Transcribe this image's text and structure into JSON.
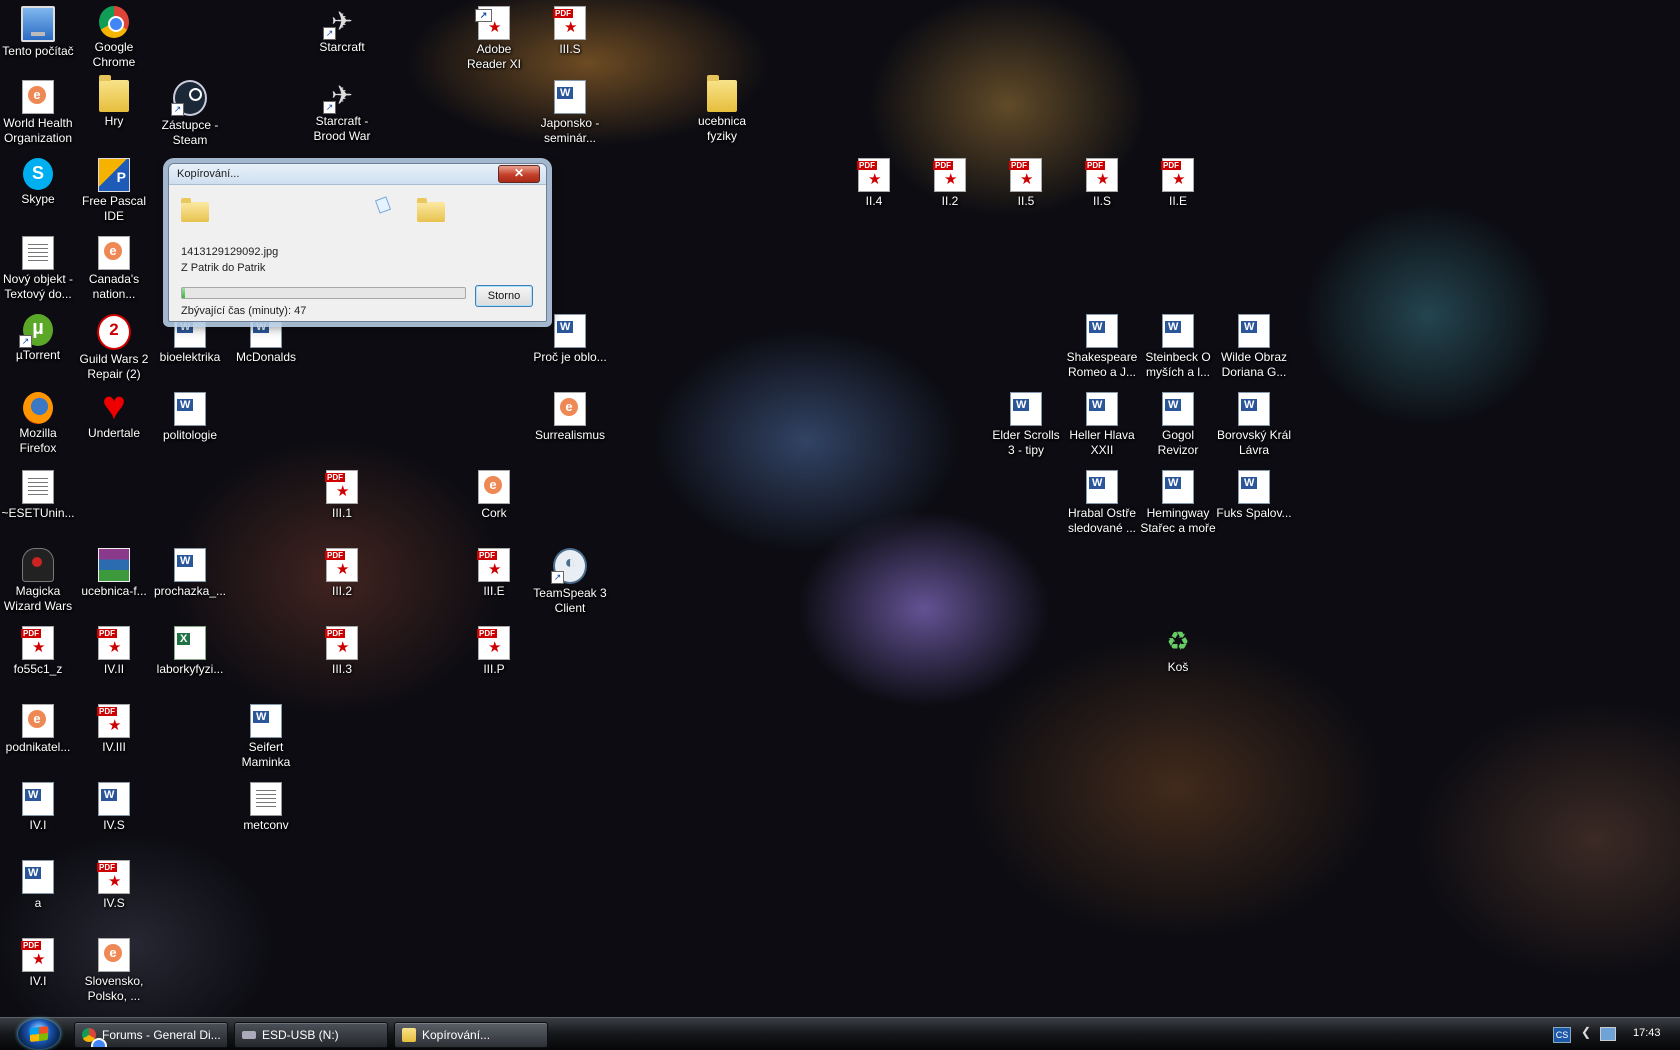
{
  "desktop_icons": [
    {
      "label": "Tento počítač",
      "icon": "computer-icon"
    },
    {
      "label": "Google Chrome",
      "icon": "chrome-icon"
    },
    {
      "label": "Starcraft",
      "icon": "starcraft-icon"
    },
    {
      "label": "Adobe Reader XI",
      "icon": "pdf-icon"
    },
    {
      "label": "III.S",
      "icon": "pdf-icon"
    },
    {
      "label": "World Health Organization",
      "icon": "web-shortcut-icon"
    },
    {
      "label": "Hry",
      "icon": "folder-icon"
    },
    {
      "label": "Zástupce - Steam",
      "icon": "steam-icon"
    },
    {
      "label": "Starcraft - Brood War",
      "icon": "starcraft-icon"
    },
    {
      "label": "Japonsko - seminár...",
      "icon": "word-doc-icon"
    },
    {
      "label": "ucebnica fyziky",
      "icon": "folder-icon"
    },
    {
      "label": "Skype",
      "icon": "skype-icon"
    },
    {
      "label": "Free Pascal IDE",
      "icon": "pascal-icon"
    },
    {
      "label": "II.4",
      "icon": "pdf-icon"
    },
    {
      "label": "II.2",
      "icon": "pdf-icon"
    },
    {
      "label": "II.5",
      "icon": "pdf-icon"
    },
    {
      "label": "II.S",
      "icon": "pdf-icon"
    },
    {
      "label": "II.E",
      "icon": "pdf-icon"
    },
    {
      "label": "Nový objekt - Textový do...",
      "icon": "text-file-icon"
    },
    {
      "label": "Canada's nation...",
      "icon": "web-shortcut-icon"
    },
    {
      "label": "µTorrent",
      "icon": "utorrent-icon"
    },
    {
      "label": "Guild Wars 2 Repair (2)",
      "icon": "guildwars-icon"
    },
    {
      "label": "bioelektrika",
      "icon": "word-doc-icon"
    },
    {
      "label": "McDonalds",
      "icon": "word-doc-icon"
    },
    {
      "label": "Proč je oblo...",
      "icon": "word-doc-icon"
    },
    {
      "label": "Shakespeare Romeo a J...",
      "icon": "word-doc-icon"
    },
    {
      "label": "Steinbeck O myších a l...",
      "icon": "word-doc-icon"
    },
    {
      "label": "Wilde Obraz Doriana G...",
      "icon": "word-doc-icon"
    },
    {
      "label": "Mozilla Firefox",
      "icon": "firefox-icon"
    },
    {
      "label": "Undertale",
      "icon": "heart-icon"
    },
    {
      "label": "politologie",
      "icon": "word-doc-icon"
    },
    {
      "label": "Surrealismus",
      "icon": "web-shortcut-icon"
    },
    {
      "label": "Elder Scrolls 3 - tipy",
      "icon": "word-doc-icon"
    },
    {
      "label": "Heller Hlava XXII",
      "icon": "word-doc-icon"
    },
    {
      "label": "Gogol Revizor",
      "icon": "word-doc-icon"
    },
    {
      "label": "Borovský Král Lávra",
      "icon": "word-doc-icon"
    },
    {
      "label": "~ESETUnin...",
      "icon": "text-file-icon"
    },
    {
      "label": "III.1",
      "icon": "pdf-icon"
    },
    {
      "label": "Cork",
      "icon": "web-shortcut-icon"
    },
    {
      "label": "Hrabal Ostře sledované ...",
      "icon": "word-doc-icon"
    },
    {
      "label": "Hemingway Stařec a moře",
      "icon": "word-doc-icon"
    },
    {
      "label": "Fuks Spalov...",
      "icon": "word-doc-icon"
    },
    {
      "label": "Magicka Wizard Wars",
      "icon": "magicka-icon"
    },
    {
      "label": "ucebnica-f...",
      "icon": "winrar-icon"
    },
    {
      "label": "prochazka_...",
      "icon": "word-doc-icon"
    },
    {
      "label": "III.2",
      "icon": "pdf-icon"
    },
    {
      "label": "III.E",
      "icon": "pdf-icon"
    },
    {
      "label": "TeamSpeak 3 Client",
      "icon": "teamspeak-icon"
    },
    {
      "label": "fo55c1_z",
      "icon": "pdf-icon"
    },
    {
      "label": "IV.II",
      "icon": "pdf-icon"
    },
    {
      "label": "laborkyfyzi...",
      "icon": "excel-icon"
    },
    {
      "label": "III.3",
      "icon": "pdf-icon"
    },
    {
      "label": "III.P",
      "icon": "pdf-icon"
    },
    {
      "label": "Koš",
      "icon": "recycle-bin-icon"
    },
    {
      "label": "podnikatel...",
      "icon": "web-shortcut-icon"
    },
    {
      "label": "IV.III",
      "icon": "pdf-icon"
    },
    {
      "label": "Seifert Maminka",
      "icon": "word-doc-icon"
    },
    {
      "label": "IV.I",
      "icon": "word-doc-icon"
    },
    {
      "label": "IV.S",
      "icon": "word-doc-icon"
    },
    {
      "label": "metconv",
      "icon": "text-file-icon"
    },
    {
      "label": "a",
      "icon": "word-doc-icon"
    },
    {
      "label": "IV.S",
      "icon": "pdf-icon"
    },
    {
      "label": "IV.I",
      "icon": "pdf-icon"
    },
    {
      "label": "Slovensko, Polsko, ...",
      "icon": "web-shortcut-icon"
    }
  ],
  "dialog": {
    "title": "Kopírování...",
    "close_label": "✕",
    "file_name": "1413129129092.jpg",
    "route": "Z Patrik do Patrik",
    "progress": 0.01,
    "cancel_label": "Storno",
    "remaining": "Zbývající čas (minuty): 47"
  },
  "taskbar": {
    "tasks": [
      {
        "label": "Forums - General Di...",
        "icon": "chrome-icon"
      },
      {
        "label": "ESD-USB (N:)",
        "icon": "drive-icon"
      },
      {
        "label": "Kopírování...",
        "icon": "folder-icon"
      }
    ],
    "tray": {
      "language": "CS",
      "clock": "17:43"
    }
  }
}
